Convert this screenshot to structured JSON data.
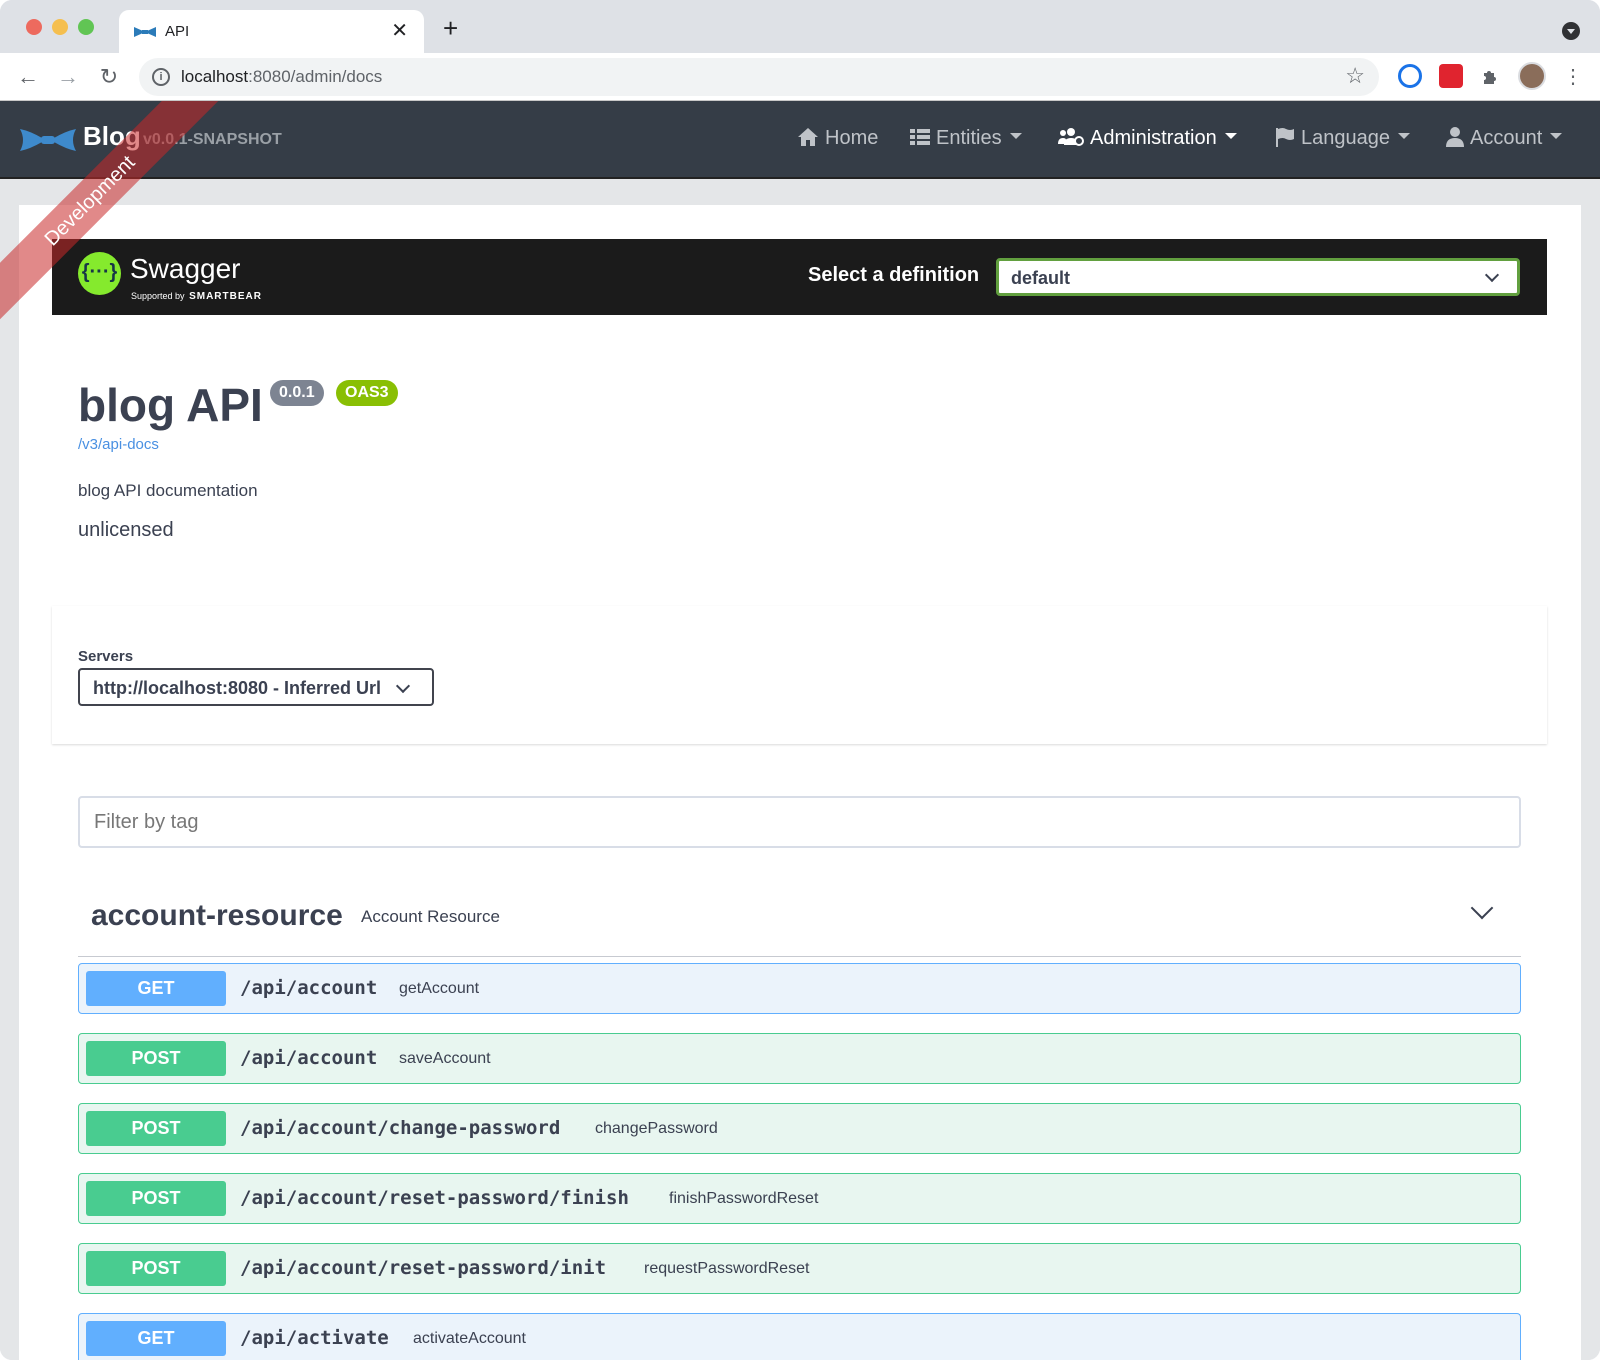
{
  "browser": {
    "tab_title": "API",
    "url_host": "localhost",
    "url_rest": ":8080/admin/docs"
  },
  "appnav": {
    "brand": "Blog",
    "version": "v0.0.1-SNAPSHOT",
    "ribbon": "Development",
    "items": [
      {
        "label": "Home",
        "icon": "home-icon"
      },
      {
        "label": "Entities",
        "icon": "list-icon"
      },
      {
        "label": "Administration",
        "icon": "users-cog-icon"
      },
      {
        "label": "Language",
        "icon": "flag-icon"
      },
      {
        "label": "Account",
        "icon": "user-icon"
      }
    ]
  },
  "swagger": {
    "logo_glyph": "{···}",
    "name": "Swagger",
    "supported_by": "Supported by",
    "smartbear": "SMARTBEAR",
    "select_label": "Select a definition",
    "selected_definition": "default"
  },
  "info": {
    "title": "blog API",
    "version_badge": "0.0.1",
    "oas_badge": "OAS3",
    "docs_link": "/v3/api-docs",
    "description": "blog API documentation",
    "license": "unlicensed"
  },
  "servers": {
    "label": "Servers",
    "selected": "http://localhost:8080 - Inferred Url"
  },
  "filter": {
    "placeholder": "Filter by tag"
  },
  "tag": {
    "name": "account-resource",
    "description": "Account Resource"
  },
  "operations": [
    {
      "method": "GET",
      "path": "/api/account",
      "summary": "getAccount"
    },
    {
      "method": "POST",
      "path": "/api/account",
      "summary": "saveAccount"
    },
    {
      "method": "POST",
      "path": "/api/account/change-password",
      "summary": "changePassword"
    },
    {
      "method": "POST",
      "path": "/api/account/reset-password/finish",
      "summary": "finishPasswordReset"
    },
    {
      "method": "POST",
      "path": "/api/account/reset-password/init",
      "summary": "requestPasswordReset"
    },
    {
      "method": "GET",
      "path": "/api/activate",
      "summary": "activateAccount"
    }
  ],
  "colors": {
    "get": "#61affe",
    "post": "#49cc90",
    "navbar": "#353d47",
    "swagger_green": "#85ea2d"
  }
}
